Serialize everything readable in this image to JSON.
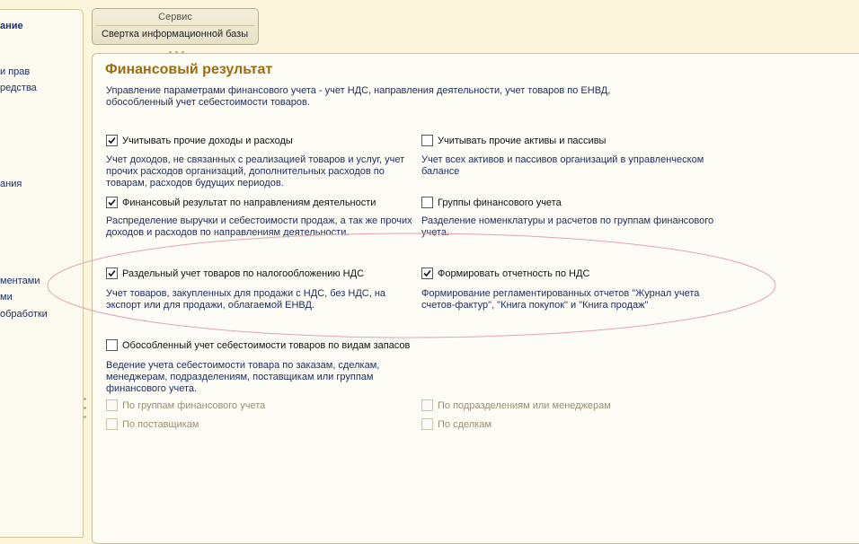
{
  "left_nav": {
    "items": [
      {
        "label": "ание",
        "bold": true
      },
      {
        "label": "и прав",
        "bold": false
      },
      {
        "label": "редства",
        "bold": false
      },
      {
        "label": "ания",
        "bold": false
      },
      {
        "label": "ментами",
        "bold": false
      },
      {
        "label": "ми",
        "bold": false
      },
      {
        "label": "обработки",
        "bold": false
      }
    ]
  },
  "service": {
    "title": "Сервис",
    "link": "Свертка информационной базы"
  },
  "main": {
    "title": "Финансовый результат",
    "description_lines": [
      "Управление параметрами финансового учета - учет НДС, направления деятельности, учет товаров по ЕНВД,",
      "обособленный учет себестоимости товаров."
    ],
    "options": [
      {
        "label": "Учитывать прочие доходы и расходы",
        "checked": true,
        "description_lines": [
          "Учет доходов, не связанных с реализацией товаров и услуг, учет",
          "прочих расходов организаций, дополнительных расходов по",
          "товарам, расходов будущих периодов."
        ]
      },
      {
        "label": "Учитывать прочие активы и пассивы",
        "checked": false,
        "description_lines": [
          "Учет всех активов и пассивов организаций в управленческом",
          "балансе"
        ]
      },
      {
        "label": "Финансовый результат по направлениям деятельности",
        "checked": true,
        "description_lines": [
          "Распределение выручки и себестоимости продаж, а так же прочих",
          "доходов и расходов по направлениям деятельности."
        ]
      },
      {
        "label": "Группы финансового учета",
        "checked": false,
        "description_lines": [
          "Разделение номенклатуры и расчетов по группам финансового",
          "учета."
        ]
      },
      {
        "label": "Раздельный учет товаров по налогообложению НДС",
        "checked": true,
        "description_lines": [
          "Учет товаров, закупленных для продажи с НДС, без НДС, на",
          "экспорт или для продажи, облагаемой ЕНВД."
        ]
      },
      {
        "label": "Формировать отчетность по НДС",
        "checked": true,
        "description_lines": [
          "Формирование регламентированных отчетов \"Журнал учета",
          "счетов-фактур\", \"Книга покупок\" и \"Книга продаж\""
        ]
      },
      {
        "label": "Обособленный учет себестоимости товаров по видам запасов",
        "checked": false,
        "description_lines": [
          "Ведение учета себестоимости товара по заказам, сделкам,",
          "менеджерам, подразделениям, поставщикам или группам",
          "финансового учета."
        ]
      }
    ],
    "sub_options": [
      {
        "label": "По группам финансового учета",
        "checked": false,
        "disabled": true
      },
      {
        "label": "По подразделениям или менеджерам",
        "checked": false,
        "disabled": true
      },
      {
        "label": "По поставщикам",
        "checked": false,
        "disabled": true
      },
      {
        "label": "По сделкам",
        "checked": false,
        "disabled": true
      }
    ]
  },
  "annotation": {
    "color": "#e2a3b6"
  }
}
